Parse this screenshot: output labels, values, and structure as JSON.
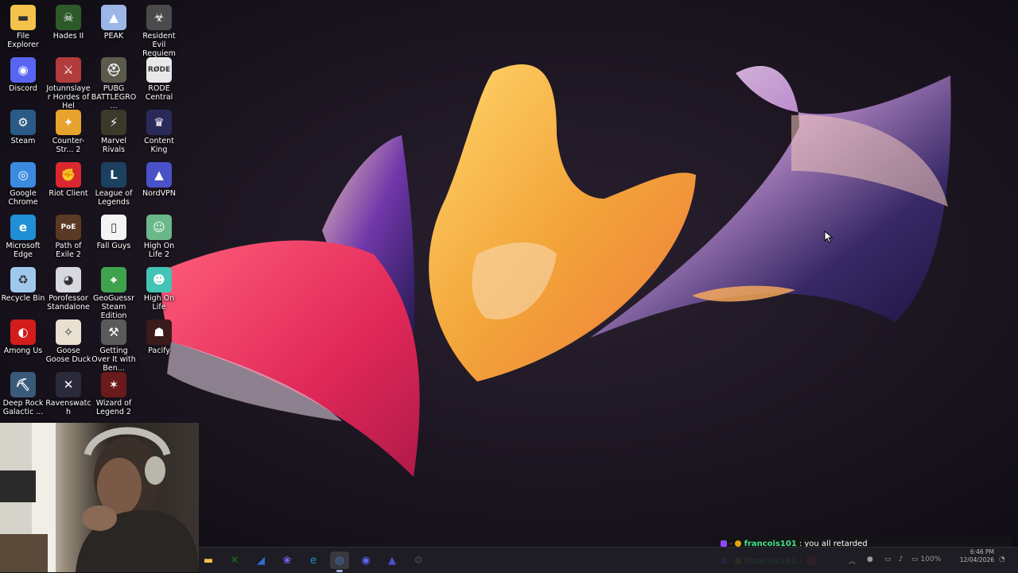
{
  "desktop": {
    "icons": [
      {
        "label": "File Explorer",
        "icon": "folder-icon",
        "color": "#f2c24a",
        "glyph": "▬"
      },
      {
        "label": "Hades II",
        "icon": "hades-icon",
        "color": "#2e5a2a",
        "glyph": "☠"
      },
      {
        "label": "PEAK",
        "icon": "peak-icon",
        "color": "#9cb6e8",
        "glyph": "▲"
      },
      {
        "label": "Resident Evil Requiem",
        "icon": "resident-evil-icon",
        "color": "#4a4a4a",
        "glyph": "☣"
      },
      {
        "label": "Discord",
        "icon": "discord-icon",
        "color": "#5865f2",
        "glyph": "◉"
      },
      {
        "label": "Jotunnslayer Hordes of Hel",
        "icon": "jotunnslayer-icon",
        "color": "#b23b3b",
        "glyph": "⚔"
      },
      {
        "label": "PUBG BATTLEGRO...",
        "icon": "pubg-icon",
        "color": "#5b5b4d",
        "glyph": "⛑"
      },
      {
        "label": "RODE Central",
        "icon": "rode-icon",
        "color": "#e8e8e8",
        "glyph": "RØDE"
      },
      {
        "label": "Steam",
        "icon": "steam-icon",
        "color": "#2a5b86",
        "glyph": "⚙"
      },
      {
        "label": "Counter-Str... 2",
        "icon": "counter-strike-icon",
        "color": "#e8a22e",
        "glyph": "✦"
      },
      {
        "label": "Marvel Rivals",
        "icon": "marvel-rivals-icon",
        "color": "#3a3a2a",
        "glyph": "⚡"
      },
      {
        "label": "Content King",
        "icon": "content-king-icon",
        "color": "#2a2a5a",
        "glyph": "♛"
      },
      {
        "label": "Google Chrome",
        "icon": "chrome-icon",
        "color": "#3b8ae0",
        "glyph": "◎"
      },
      {
        "label": "Riot Client",
        "icon": "riot-client-icon",
        "color": "#d9282f",
        "glyph": "✊"
      },
      {
        "label": "League of Legends",
        "icon": "league-icon",
        "color": "#1c4060",
        "glyph": "L"
      },
      {
        "label": "NordVPN",
        "icon": "nordvpn-icon",
        "color": "#4a52c8",
        "glyph": "▲"
      },
      {
        "label": "Microsoft Edge",
        "icon": "edge-icon",
        "color": "#1f8fd6",
        "glyph": "e"
      },
      {
        "label": "Path of Exile 2",
        "icon": "path-of-exile-icon",
        "color": "#5a3a24",
        "glyph": "PoE"
      },
      {
        "label": "Fall Guys",
        "icon": "fall-guys-icon",
        "color": "#f4f4f4",
        "glyph": "▯"
      },
      {
        "label": "High On Life 2",
        "icon": "high-on-life-2-icon",
        "color": "#6ab88a",
        "glyph": "☺"
      },
      {
        "label": "Recycle Bin",
        "icon": "recycle-bin-icon",
        "color": "#9fc8ec",
        "glyph": "♻"
      },
      {
        "label": "Porofessor Standalone",
        "icon": "porofessor-icon",
        "color": "#d8d8e0",
        "glyph": "◕"
      },
      {
        "label": "GeoGuessr Steam Edition",
        "icon": "geoguessr-icon",
        "color": "#3fa34d",
        "glyph": "⌖"
      },
      {
        "label": "High On Life",
        "icon": "high-on-life-icon",
        "color": "#43c4b4",
        "glyph": "☻"
      },
      {
        "label": "Among Us",
        "icon": "among-us-icon",
        "color": "#d31c1c",
        "glyph": "◐"
      },
      {
        "label": "Goose Goose Duck",
        "icon": "goose-goose-duck-icon",
        "color": "#e8e0d0",
        "glyph": "✧"
      },
      {
        "label": "Getting Over It with Ben...",
        "icon": "getting-over-it-icon",
        "color": "#5a5a5a",
        "glyph": "⚒"
      },
      {
        "label": "Pacify",
        "icon": "pacify-icon",
        "color": "#3a1a1a",
        "glyph": "☗"
      },
      {
        "label": "Deep Rock Galactic ...",
        "icon": "deep-rock-icon",
        "color": "#3a5a7a",
        "glyph": "⛏"
      },
      {
        "label": "Ravenswatch",
        "icon": "ravenswatch-icon",
        "color": "#2a2a3a",
        "glyph": "✕"
      },
      {
        "label": "Wizard of Legend 2",
        "icon": "wizard-of-legend-icon",
        "color": "#6a1a1a",
        "glyph": "✶"
      }
    ]
  },
  "taskbar": {
    "items": [
      {
        "name": "file-explorer-taskbar-icon",
        "glyph": "▬",
        "color": "#f2c24a",
        "active": false
      },
      {
        "name": "xbox-taskbar-icon",
        "glyph": "✕",
        "color": "#107c10",
        "active": false
      },
      {
        "name": "app-taskbar-icon",
        "glyph": "◢",
        "color": "#2f6bd6",
        "active": false
      },
      {
        "name": "copilot-taskbar-icon",
        "glyph": "❀",
        "color": "#8b5cf6",
        "active": false
      },
      {
        "name": "edge-taskbar-icon",
        "glyph": "e",
        "color": "#1f8fd6",
        "active": false
      },
      {
        "name": "chrome-taskbar-icon",
        "glyph": "◎",
        "color": "#3b8ae0",
        "active": true
      },
      {
        "name": "discord-taskbar-icon",
        "glyph": "◉",
        "color": "#5865f2",
        "active": false
      },
      {
        "name": "nordvpn-taskbar-icon",
        "glyph": "▲",
        "color": "#4a52c8",
        "active": false
      },
      {
        "name": "steam-taskbar-icon",
        "glyph": "⚙",
        "color": "#44464c",
        "active": false
      }
    ],
    "clock": {
      "time": "6:46 PM",
      "date": "12/04/2026"
    },
    "battery": "100%"
  },
  "chat": [
    {
      "user": "francois101",
      "message": ": you all retarded"
    },
    {
      "user": "francois101",
      "message": ":"
    }
  ]
}
